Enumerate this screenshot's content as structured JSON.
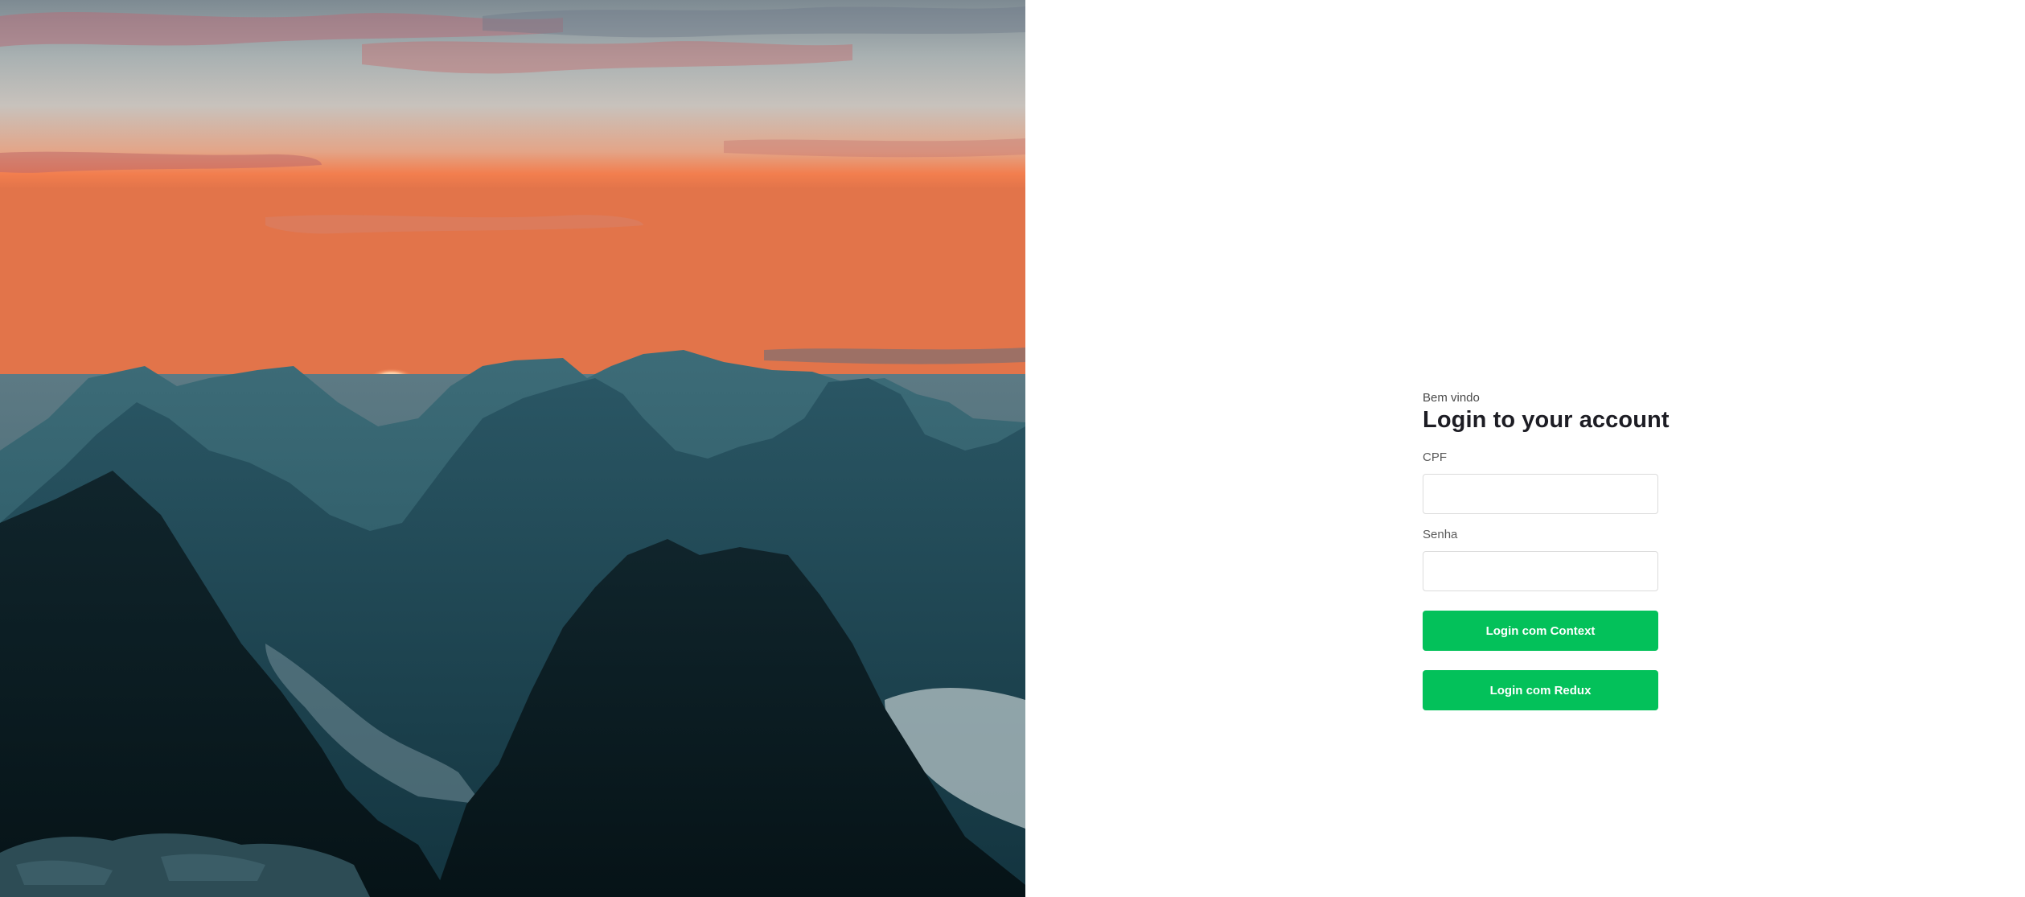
{
  "hero": {
    "image": "mountain-sunset-landscape"
  },
  "login": {
    "welcome": "Bem vindo",
    "title": "Login to your account",
    "cpf_label": "CPF",
    "cpf_value": "",
    "password_label": "Senha",
    "password_value": "",
    "context_button": "Login com Context",
    "redux_button": "Login com Redux"
  },
  "colors": {
    "primary": "#03c15a",
    "title": "#1d1d24",
    "label": "#5a5a5a",
    "input_border": "#dcdcdc"
  }
}
